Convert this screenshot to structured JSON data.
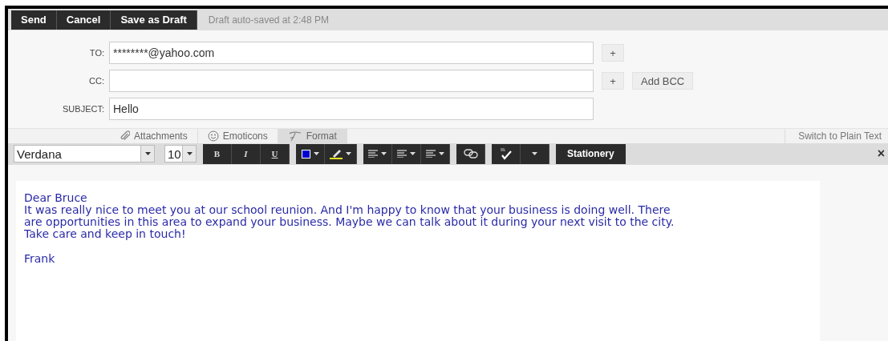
{
  "actions": {
    "buttons": [
      {
        "label": "Send"
      },
      {
        "label": "Cancel"
      },
      {
        "label": "Save as Draft"
      }
    ],
    "status": "Draft auto-saved at 2:48 PM"
  },
  "fields": [
    {
      "label": "TO:",
      "value": "********@yahoo.com",
      "add": "+"
    },
    {
      "label": "CC:",
      "add": "+",
      "extra": "Add BCC"
    },
    {
      "label": "SUBJECT:",
      "value": "Hello"
    }
  ],
  "tabs": [
    {
      "kind": "attach",
      "label": "Attachments",
      "selected": false
    },
    {
      "kind": "emoticon",
      "label": "Emoticons",
      "selected": false
    },
    {
      "kind": "format",
      "label": "Format",
      "selected": true
    }
  ],
  "switch_link": "Switch to Plain Text",
  "toolbar": {
    "font": "Verdana",
    "size": "10",
    "styles": [
      "B",
      "I",
      "U"
    ],
    "stationery": "Stationery",
    "close": "×"
  },
  "body": [
    {
      "lines": [
        "Dear Bruce",
        "It was really nice to meet you at our school reunion. And I'm happy to know that your business is doing well. There",
        "are opportunities in this area to expand your business. Maybe we can talk about it during your next visit to the city.",
        "Take care and keep in touch!"
      ]
    },
    {
      "lines": [
        "Frank"
      ]
    }
  ]
}
